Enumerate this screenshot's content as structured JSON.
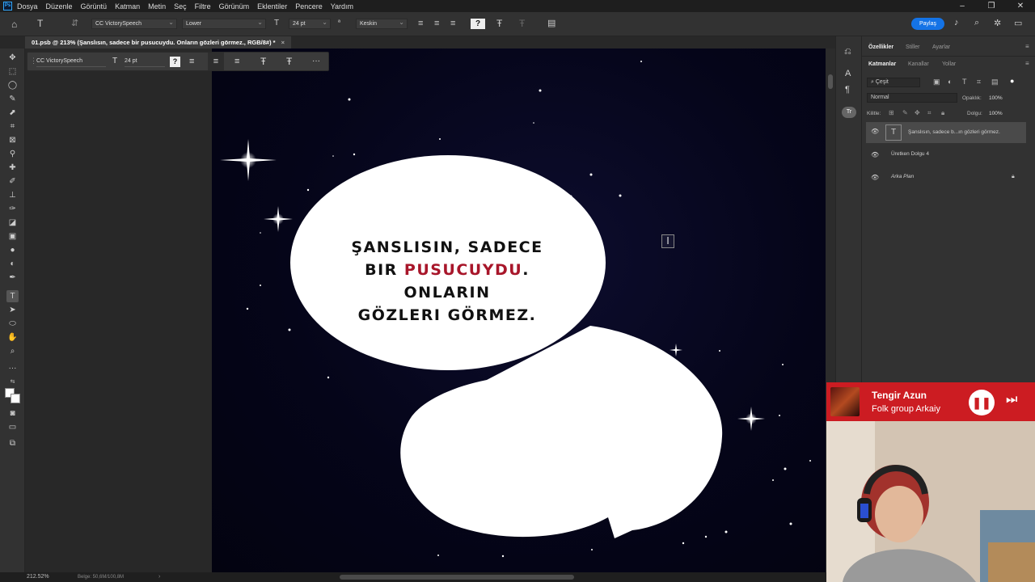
{
  "menubar": {
    "items": [
      "Dosya",
      "Düzenle",
      "Görüntü",
      "Katman",
      "Metin",
      "Seç",
      "Filtre",
      "Görünüm",
      "Eklentiler",
      "Pencere",
      "Yardım"
    ]
  },
  "options": {
    "font_family": "CC VictorySpeech",
    "font_style": "Lower",
    "font_size": "24 pt",
    "antialias": "Keskin",
    "share_label": "Paylaş"
  },
  "document": {
    "tab_title": "01.psb @ 213% (Şanslısın, sadece bir pusucuydu. Onların gözleri görmez., RGB/8#) *",
    "close_glyph": "×"
  },
  "context_bar": {
    "font_family": "CC VictorySpeech",
    "font_size": "24 pt",
    "more_glyph": "···"
  },
  "speech": {
    "line1": "ŞANSLISIN, SADECE",
    "line2_pre": "BIR ",
    "line2_highlight": "PUSUCUYDU",
    "line2_post": ". ONLARIN",
    "line3": "GÖZLERI GÖRMEZ.",
    "highlight_color": "#a8162a"
  },
  "status": {
    "zoom": "212.52%",
    "doc_size": "Belge: 50,6M/100,8M"
  },
  "panels": {
    "top_tabs": [
      "Özellikler",
      "Stiller",
      "Ayarlar"
    ],
    "layer_tabs": [
      "Katmanlar",
      "Kanallar",
      "Yollar"
    ],
    "filter_label": "Çeşit",
    "blend_mode": "Normal",
    "opacity_label": "Opaklık:",
    "opacity_value": "100%",
    "lock_label": "Kilitle:",
    "fill_label": "Dolgu:",
    "fill_value": "100%",
    "layers": [
      {
        "name": "Şanslısın, sadece b...ın gözleri görmez.",
        "kind": "text"
      },
      {
        "name": "Üretken Dolgu 4",
        "kind": "fill"
      },
      {
        "name": "Arka Plan",
        "kind": "background"
      }
    ]
  },
  "music": {
    "title": "Tengir Azun",
    "artist": "Folk group Arkaiy"
  },
  "colors": {
    "accent": "#1473e6",
    "music_bg": "#cc1c22"
  }
}
